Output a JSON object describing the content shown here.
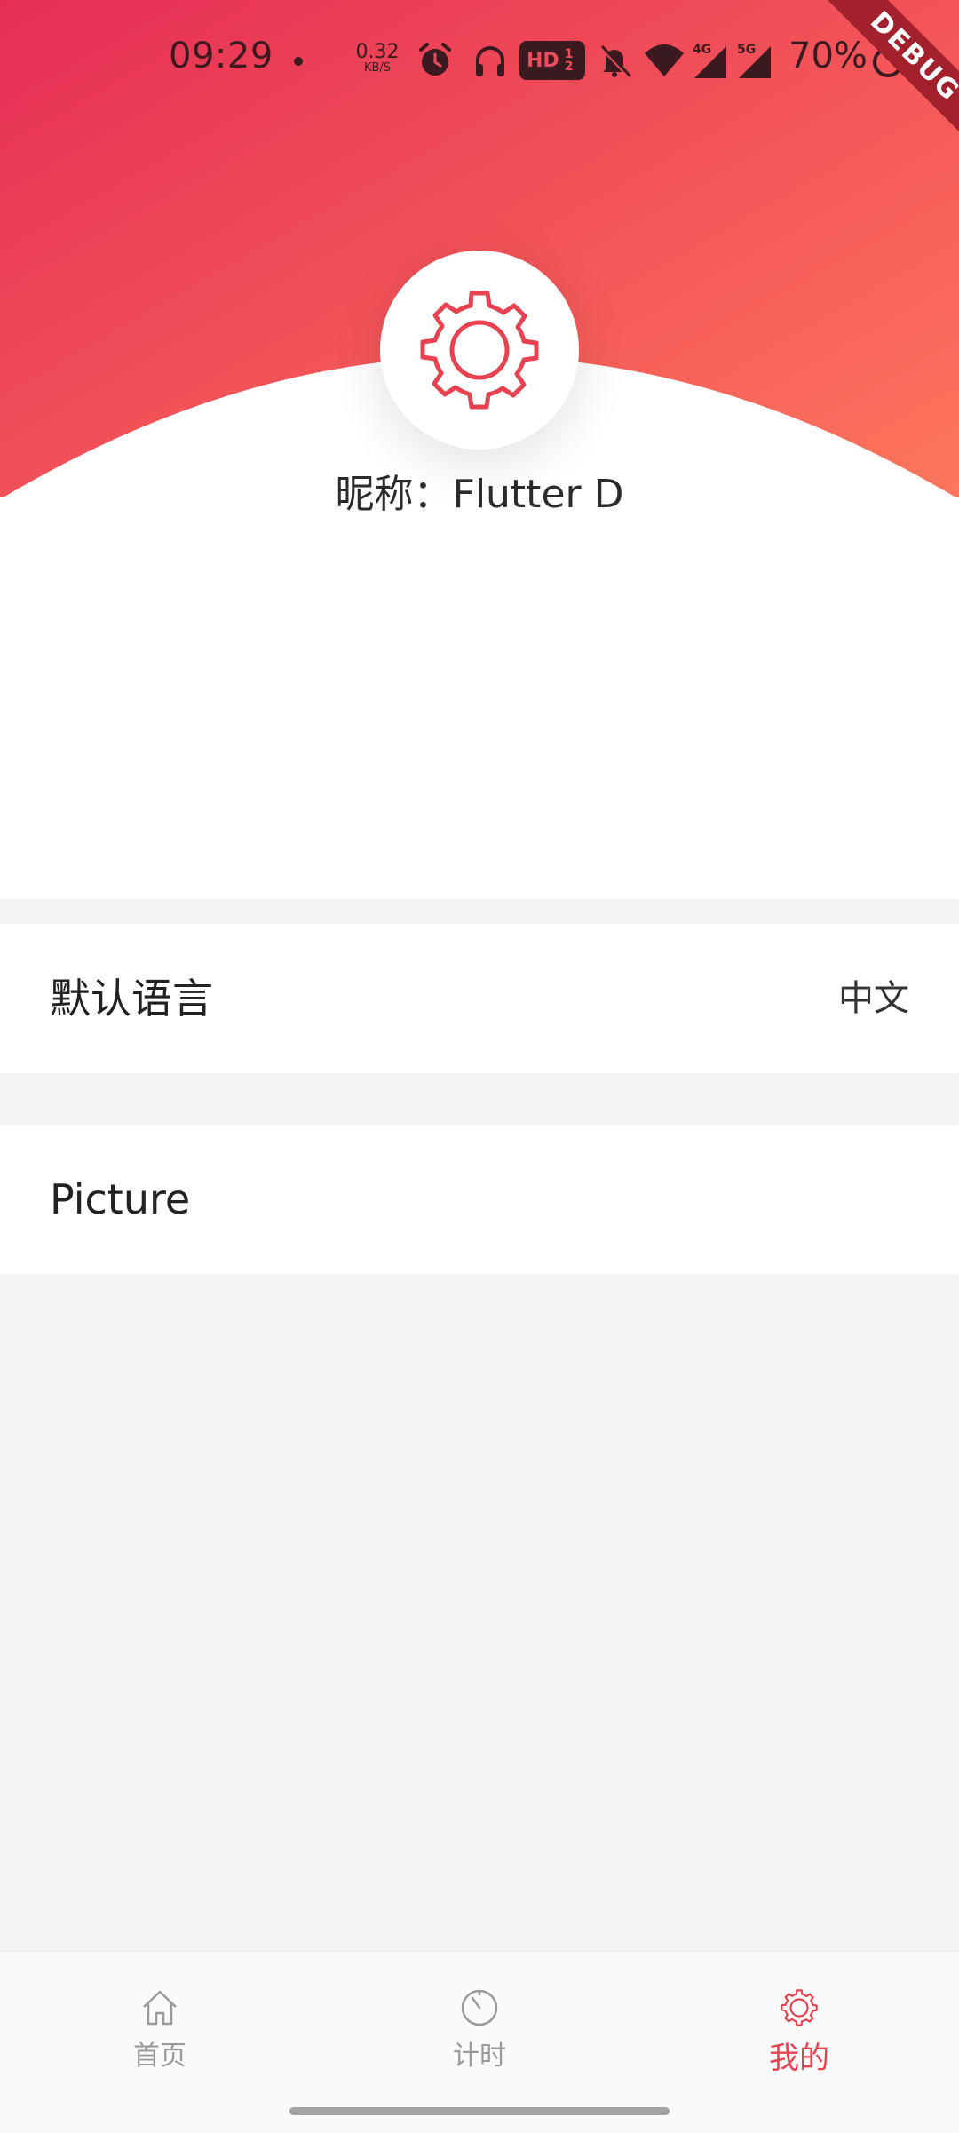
{
  "status_bar": {
    "time": "09:29",
    "net_speed_value": "0.32",
    "net_speed_unit": "KB/S",
    "hd_label": "HD",
    "hd_sup": "1",
    "hd_sub": "2",
    "signal_1_label": "4G",
    "signal_2_label": "5G",
    "battery": "70%",
    "icons": [
      "alarm-icon",
      "headphones-icon",
      "hd-icon",
      "bell-off-icon",
      "wifi-icon",
      "signal-4g-icon",
      "signal-5g-icon",
      "battery-icon"
    ]
  },
  "debug_banner": "DEBUG",
  "profile": {
    "avatar_icon": "gear-icon",
    "nickname": "昵称：Flutter D"
  },
  "settings": {
    "language_label": "默认语言",
    "language_value": "中文",
    "picture_label": "Picture"
  },
  "bottom_nav": {
    "items": [
      {
        "label": "首页",
        "icon": "home-icon"
      },
      {
        "label": "计时",
        "icon": "timer-icon"
      },
      {
        "label": "我的",
        "icon": "gear-icon"
      }
    ],
    "active_index": 2
  },
  "colors": {
    "accent": "#e8414f",
    "gradient_start": "#e62e52",
    "gradient_end": "#ff7a5c",
    "background": "#f4f4f4"
  }
}
